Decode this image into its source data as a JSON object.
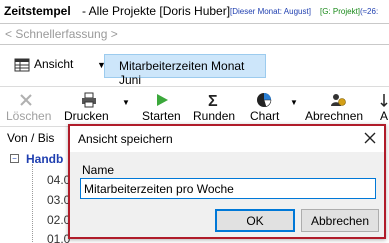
{
  "window": {
    "app_title": "Zeitstempel",
    "project_title": "- Alle Projekte [Doris Huber]",
    "month_tag": "[Dieser Monat: August]",
    "group_tag": "[G: Projekt]",
    "extra_tag": "(≈26:"
  },
  "quick_capture": {
    "placeholder": "< Schnellerfassung >"
  },
  "view_bar": {
    "view_label": "Ansicht",
    "current_view": "Mitarbeiterzeiten Monat Juni"
  },
  "toolbar": {
    "items": [
      {
        "label": "Löschen",
        "icon": "delete-x-icon",
        "enabled": false
      },
      {
        "label": "Drucken",
        "icon": "printer-icon",
        "enabled": true
      },
      {
        "label": "Starten",
        "icon": "play-icon",
        "enabled": true
      },
      {
        "label": "Runden",
        "icon": "sigma-icon",
        "enabled": true
      },
      {
        "label": "Chart",
        "icon": "pie-chart-icon",
        "enabled": true
      },
      {
        "label": "Abrechnen",
        "icon": "users-money-icon",
        "enabled": true
      },
      {
        "label": "A",
        "icon": "arrow-icon",
        "enabled": true
      }
    ]
  },
  "tree": {
    "column_header": "Von / Bis",
    "group_label": "Handb",
    "items": [
      "04.0",
      "03.0",
      "02.0",
      "01.0"
    ]
  },
  "dialog": {
    "title": "Ansicht speichern",
    "name_label": "Name",
    "name_value": "Mitarbeiterzeiten pro Woche",
    "ok_label": "OK",
    "cancel_label": "Abbrechen"
  },
  "colors": {
    "accent": "#0078d7",
    "highlight_border": "#b01c2a",
    "selected_view_bg": "#cde6fa",
    "link_blue": "#1f3fb0",
    "green": "#1a8a1a"
  }
}
